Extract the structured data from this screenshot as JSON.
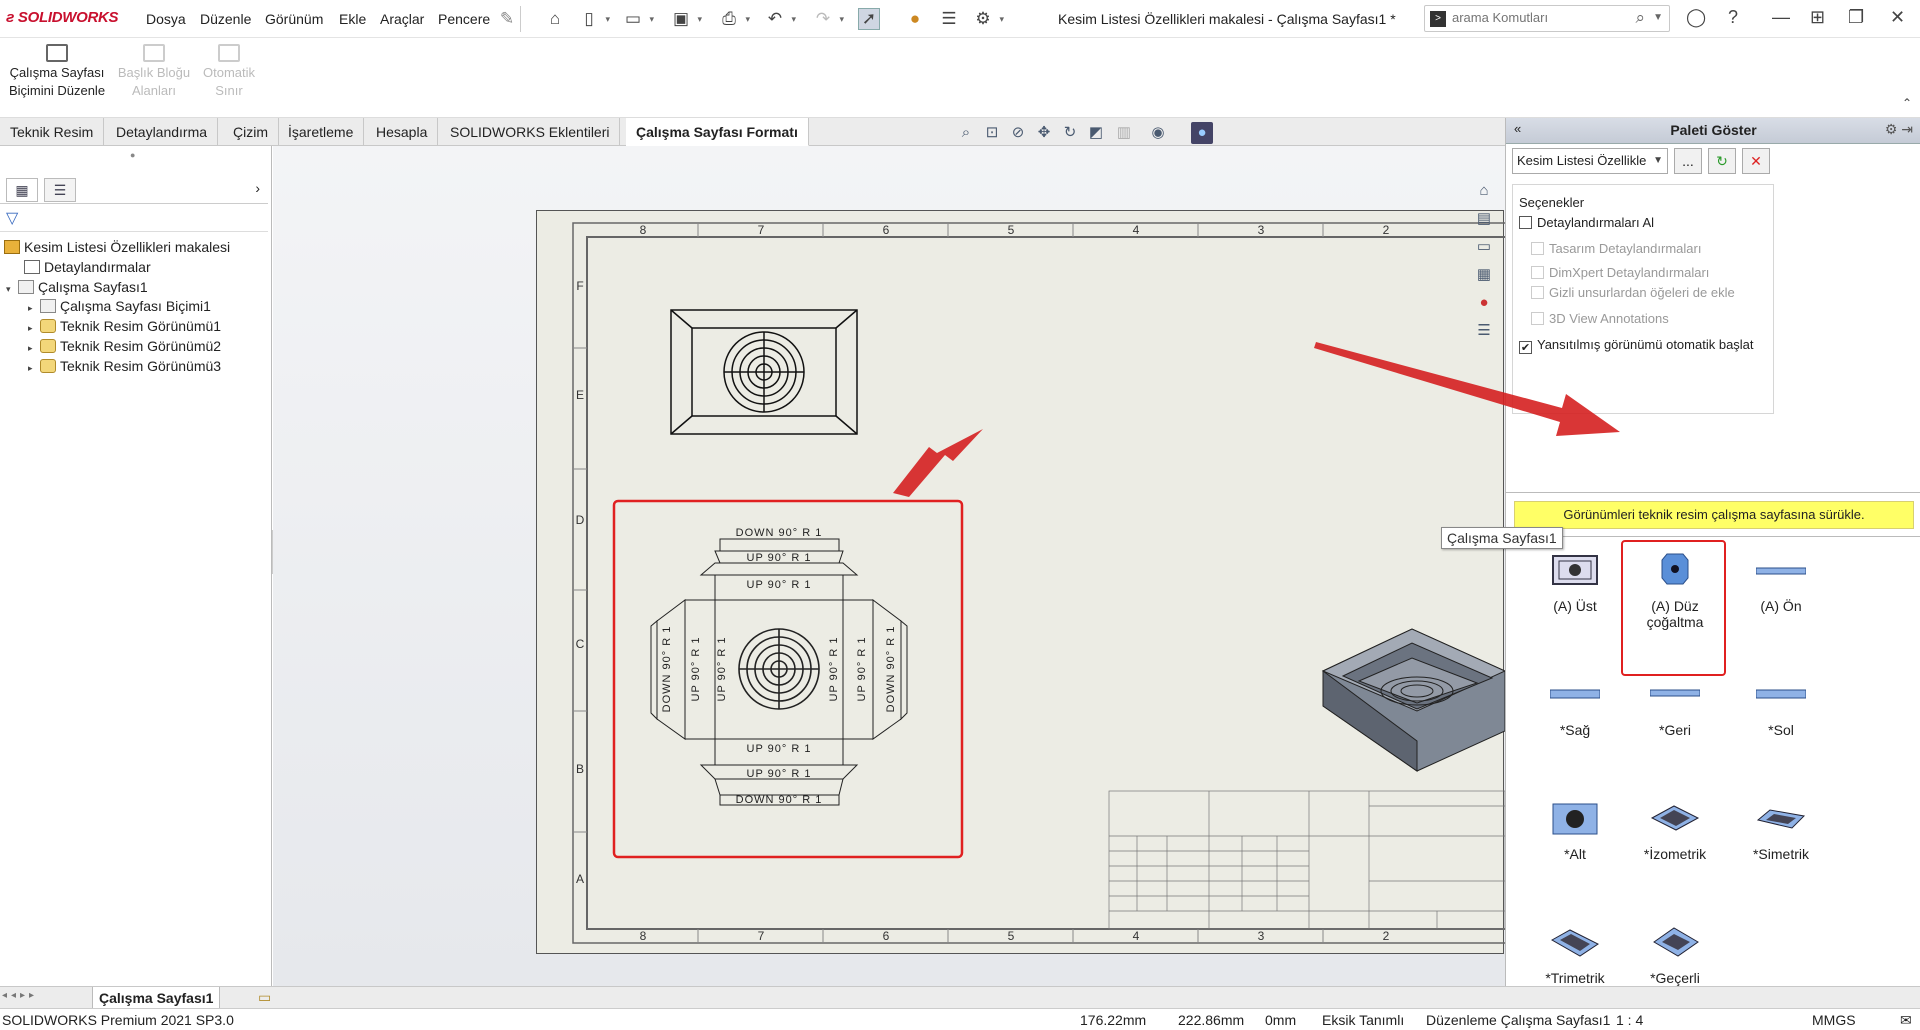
{
  "app": {
    "name": "SOLIDWORKS",
    "doc_title": "Kesim Listesi Özellikleri makalesi - Çalışma Sayfası1 *"
  },
  "menus": [
    "Dosya",
    "Düzenle",
    "Görünüm",
    "Ekle",
    "Araçlar",
    "Pencere"
  ],
  "search": {
    "placeholder": "arama Komutları"
  },
  "command_manager": {
    "buttons": [
      {
        "label_line1": "Çalışma Sayfası",
        "label_line2": "Biçimini Düzenle",
        "enabled": true
      },
      {
        "label_line1": "Başlık Bloğu",
        "label_line2": "Alanları",
        "enabled": false
      },
      {
        "label_line1": "Otomatik",
        "label_line2": "Sınır",
        "enabled": false
      }
    ]
  },
  "tabs": [
    "Teknik Resim",
    "Detaylandırma",
    "Çizim",
    "İşaretleme",
    "Hesapla",
    "SOLIDWORKS Eklentileri",
    "Çalışma Sayfası Formatı"
  ],
  "active_tab": "Çalışma Sayfası Formatı",
  "feature_tree": {
    "root": "Kesim Listesi Özellikleri makalesi",
    "items": [
      {
        "label": "Detaylandırmalar",
        "level": 1
      },
      {
        "label": "Çalışma Sayfası1",
        "level": 1
      },
      {
        "label": "Çalışma Sayfası Biçimi1",
        "level": 2
      },
      {
        "label": "Teknik Resim Görünümü1",
        "level": 2
      },
      {
        "label": "Teknik Resim Görünümü2",
        "level": 2
      },
      {
        "label": "Teknik Resim Görünümü3",
        "level": 2
      }
    ]
  },
  "drawing": {
    "zone_cols": [
      "8",
      "7",
      "6",
      "5",
      "4",
      "3",
      "2"
    ],
    "zone_rows": [
      "F",
      "E",
      "D",
      "C",
      "B",
      "A"
    ],
    "flat_labels": {
      "top": "DOWN 90° R 1",
      "up1": "UP 90° R 1",
      "up2": "UP 90° R 1",
      "up3": "UP 90° R 1",
      "up4": "UP 90° R 1",
      "bottom": "DOWN 90° R 1",
      "left_outer": "DOWN 90° R 1",
      "left_inner": "UP 90° R 1",
      "right_inner": "UP 90° R 1",
      "right_outer": "DOWN 90° R 1",
      "up_left": "UP 90° R 1",
      "up_right": "UP 90° R 1"
    }
  },
  "palette": {
    "title": "Paleti Göster",
    "combo_value": "Kesim Listesi Özellikle",
    "browse_label": "...",
    "options_header": "Seçenekler",
    "options": [
      {
        "label": "Detaylandırmaları Al",
        "checked": false,
        "enabled": true
      },
      {
        "label": "Tasarım Detaylandırmaları",
        "checked": false,
        "enabled": false
      },
      {
        "label": "DimXpert Detaylandırmaları",
        "checked": false,
        "enabled": false
      },
      {
        "label": "Gizli unsurlardan öğeleri de ekle",
        "checked": false,
        "enabled": false
      },
      {
        "label": "3D View Annotations",
        "checked": false,
        "enabled": false
      },
      {
        "label": "Yansıtılmış görünümü otomatik başlat",
        "checked": true,
        "enabled": true
      }
    ],
    "hint": "Görünümleri teknik resim çalışma sayfasına sürükle.",
    "views": [
      "(A) Üst",
      "(A) Düz çoğaltma",
      "(A) Ön",
      "*Sağ",
      "*Geri",
      "*Sol",
      "*Alt",
      "*İzometrik",
      "*Simetrik",
      "*Trimetrik",
      "*Geçerli"
    ],
    "tooltip": "Çalışma Sayfası1"
  },
  "sheet_tab": "Çalışma Sayfası1",
  "status": {
    "product": "SOLIDWORKS Premium 2021 SP3.0",
    "x": "176.22mm",
    "y": "222.86mm",
    "z": "0mm",
    "defined": "Eksik Tanımlı",
    "mode": "Düzenleme Çalışma Sayfası1",
    "scale": "1 : 4",
    "units": "MMGS"
  },
  "colors": {
    "highlight": "#e02020",
    "hint_bg": "#ffff66",
    "brand": "#c8102e"
  }
}
